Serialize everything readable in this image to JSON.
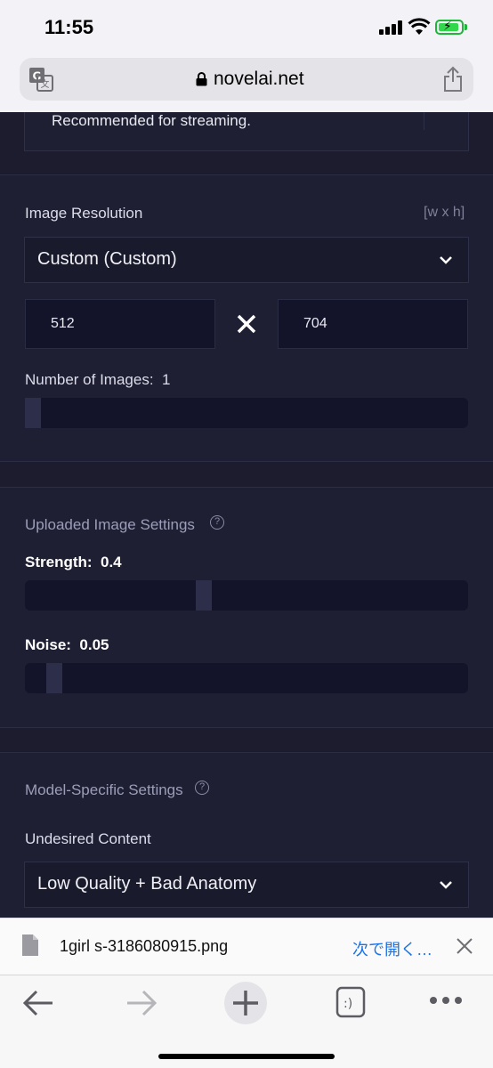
{
  "status": {
    "time": "11:55"
  },
  "browser": {
    "url": "novelai.net"
  },
  "settings": {
    "top_text": "Recommended for streaming.",
    "image_resolution": {
      "label": "Image Resolution",
      "hint": "[w x h]",
      "preset": "Custom (Custom)",
      "width": "512",
      "height": "704"
    },
    "number_of_images": {
      "label": "Number of Images:",
      "value": "1",
      "fraction": 0.0
    },
    "uploaded_image": {
      "title": "Uploaded Image Settings",
      "strength_label": "Strength:",
      "strength_value": "0.4",
      "strength_fraction": 0.4,
      "noise_label": "Noise:",
      "noise_value": "0.05",
      "noise_fraction": 0.05
    },
    "model_specific": {
      "title": "Model-Specific Settings",
      "undesired_label": "Undesired Content",
      "undesired_value": "Low Quality + Bad Anatomy"
    }
  },
  "download": {
    "filename": "1girl  s-3186080915.png",
    "open_label": "次で開く…"
  }
}
